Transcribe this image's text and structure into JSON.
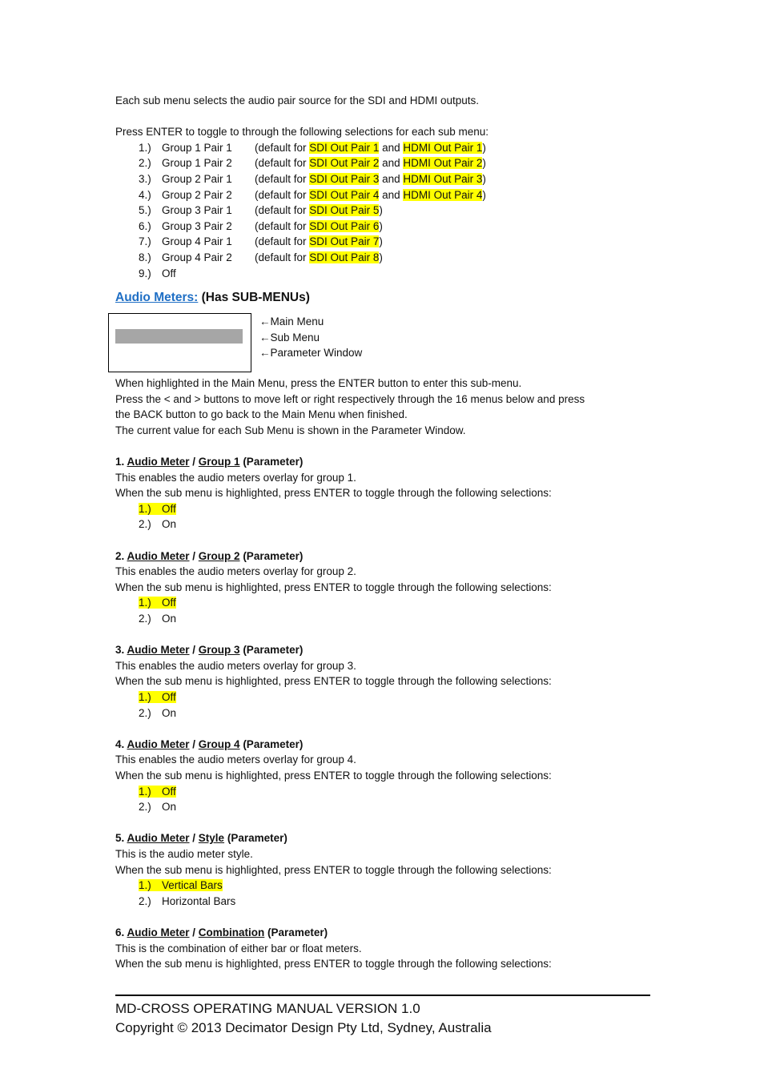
{
  "intro": {
    "line1": "Each sub menu selects the audio pair source for the SDI and HDMI outputs.",
    "line2": "Press ENTER to toggle to through the following selections for each sub menu:",
    "options": [
      {
        "num": "1.)",
        "group": "Group 1 Pair 1",
        "pre": "(default for ",
        "sdi": "SDI Out Pair 1",
        "mid": " and ",
        "hdmi": "HDMI Out Pair 1",
        "post": ")"
      },
      {
        "num": "2.)",
        "group": "Group 1 Pair 2",
        "pre": "(default for ",
        "sdi": "SDI Out Pair 2",
        "mid": " and ",
        "hdmi": "HDMI Out Pair 2",
        "post": ")"
      },
      {
        "num": "3.)",
        "group": "Group 2 Pair 1",
        "pre": "(default for ",
        "sdi": "SDI Out Pair 3",
        "mid": " and ",
        "hdmi": "HDMI Out Pair 3",
        "post": ")"
      },
      {
        "num": "4.)",
        "group": "Group 2 Pair 2",
        "pre": "(default for ",
        "sdi": "SDI Out Pair 4",
        "mid": " and ",
        "hdmi": "HDMI Out Pair 4",
        "post": ")"
      },
      {
        "num": "5.)",
        "group": "Group 3 Pair 1",
        "pre": "(default for ",
        "sdi": "SDI Out Pair 5",
        "post": ")"
      },
      {
        "num": "6.)",
        "group": "Group 3 Pair 2",
        "pre": "(default for ",
        "sdi": "SDI Out Pair 6",
        "post": ")"
      },
      {
        "num": "7.)",
        "group": "Group 4 Pair 1",
        "pre": "(default for ",
        "sdi": "SDI Out Pair 7",
        "post": ")"
      },
      {
        "num": "8.)",
        "group": "Group 4 Pair 2",
        "pre": "(default for ",
        "sdi": "SDI Out Pair 8",
        "post": ")"
      },
      {
        "num": "9.)",
        "group": "Off"
      }
    ]
  },
  "section": {
    "link": "Audio Meters:",
    "suffix": " (Has SUB-MENUs)",
    "diagram_labels": [
      "←Main Menu",
      "←Sub Menu",
      "←Parameter Window"
    ],
    "para": [
      "When highlighted in the Main Menu, press the ENTER button to enter this sub-menu.",
      "Press the < and > buttons to move left or right respectively through the 16 menus below and press",
      "the BACK button to go back to the Main Menu when finished.",
      "The current value for each Sub Menu is shown in the Parameter Window."
    ]
  },
  "subs": [
    {
      "n": "1. ",
      "a": "Audio Meter",
      "sep": " / ",
      "b": "Group 1",
      "p": " (Parameter)",
      "desc": "This enables the audio meters overlay for group 1.",
      "instr": "When the sub menu is highlighted, press ENTER to toggle through the following selections:",
      "opts": [
        [
          "1.)",
          "Off"
        ],
        [
          "2.)",
          "On"
        ]
      ]
    },
    {
      "n": "2. ",
      "a": "Audio Meter",
      "sep": " / ",
      "b": "Group 2",
      "p": " (Parameter)",
      "desc": "This enables the audio meters overlay for group 2.",
      "instr": "When the sub menu is highlighted, press ENTER to toggle through the following selections:",
      "opts": [
        [
          "1.)",
          "Off"
        ],
        [
          "2.)",
          "On"
        ]
      ]
    },
    {
      "n": "3. ",
      "a": "Audio Meter",
      "sep": " / ",
      "b": "Group 3",
      "p": " (Parameter)",
      "desc": "This enables the audio meters overlay for group 3.",
      "instr": "When the sub menu is highlighted, press ENTER to toggle through the following selections:",
      "opts": [
        [
          "1.)",
          "Off"
        ],
        [
          "2.)",
          "On"
        ]
      ]
    },
    {
      "n": "4. ",
      "a": "Audio Meter",
      "sep": " / ",
      "b": "Group 4",
      "p": " (Parameter)",
      "desc": "This enables the audio meters overlay for group 4.",
      "instr": "When the sub menu is highlighted, press ENTER to toggle through the following selections:",
      "opts": [
        [
          "1.)",
          "Off"
        ],
        [
          "2.)",
          "On"
        ]
      ]
    },
    {
      "n": "5. ",
      "a": "Audio Meter",
      "sep": " / ",
      "b": "Style",
      "p": " (Parameter)",
      "desc": "This is the audio meter style.",
      "instr": "When the sub menu is highlighted, press ENTER to toggle through the following selections:",
      "opts": [
        [
          "1.)",
          "Vertical Bars"
        ],
        [
          "2.)",
          "Horizontal Bars"
        ]
      ]
    },
    {
      "n": "6. ",
      "a": "Audio Meter",
      "sep": " / ",
      "b": "Combination",
      "p": " (Parameter)",
      "desc": "This is the combination of either bar or float meters.",
      "instr": "When the sub menu is highlighted, press ENTER to toggle through the following selections:",
      "opts": []
    }
  ],
  "footer": {
    "line1": "MD-CROSS OPERATING MANUAL VERSION 1.0",
    "line2": "Copyright © 2013 Decimator Design Pty Ltd, Sydney, Australia"
  },
  "colors": {
    "highlight": "#ffff00",
    "link": "#1f6fc5",
    "gray_bar": "#a6a6a6"
  }
}
